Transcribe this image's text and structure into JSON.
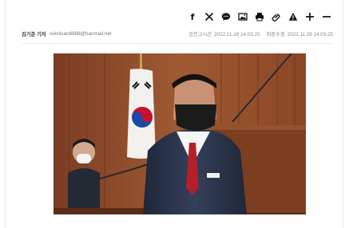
{
  "toolbar": {
    "icons": [
      "facebook-icon",
      "x-icon",
      "chat-icon",
      "image-icon",
      "print-icon",
      "link-icon",
      "alert-icon",
      "plus-icon",
      "minus-icon"
    ],
    "facebook_glyph": "f",
    "x_glyph": "𝕏"
  },
  "meta": {
    "reporter": "김기준 기자",
    "email": "soknisan8888@hanmail.net",
    "published_label": "승인고시간",
    "published": "2022.11.28 14:03:25",
    "modified_label": "최종수정",
    "modified": "2022.11.28 14:03:25"
  },
  "colors": {
    "accent": "#111111",
    "wood_wall": "#8a4a2a",
    "suit": "#2a3345",
    "tie": "#b3202a"
  }
}
